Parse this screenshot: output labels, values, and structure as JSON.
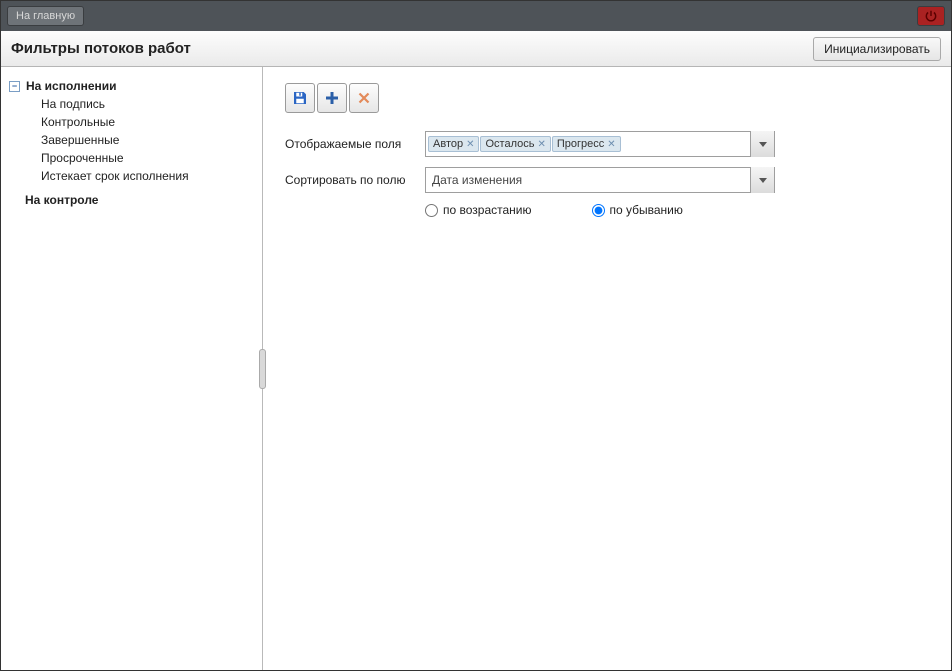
{
  "topbar": {
    "home_label": "На главную"
  },
  "titlebar": {
    "title": "Фильтры потоков работ",
    "init_label": "Инициализировать"
  },
  "sidebar": {
    "root": {
      "label": "На исполнении",
      "children": [
        {
          "label": "На подпись"
        },
        {
          "label": "Контрольные"
        },
        {
          "label": "Завершенные"
        },
        {
          "label": "Просроченные"
        },
        {
          "label": "Истекает срок исполнения"
        }
      ]
    },
    "second": {
      "label": "На контроле"
    }
  },
  "form": {
    "displayed_fields_label": "Отображаемые поля",
    "displayed_fields_tags": [
      "Автор",
      "Осталось",
      "Прогресс"
    ],
    "sort_by_label": "Сортировать по полю",
    "sort_by_value": "Дата изменения",
    "sort_asc_label": "по возрастанию",
    "sort_desc_label": "по убыванию",
    "sort_selected": "desc"
  }
}
